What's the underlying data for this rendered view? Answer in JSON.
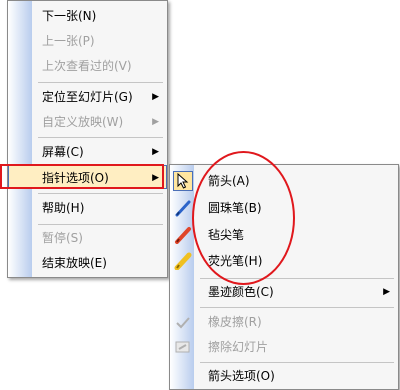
{
  "menu_main": {
    "items": [
      {
        "label": "下一张(N)",
        "disabled": false
      },
      {
        "label": "上一张(P)",
        "disabled": true
      },
      {
        "label": "上次查看过的(V)",
        "disabled": true
      },
      {
        "label": "定位至幻灯片(G)",
        "disabled": false,
        "submenu": true
      },
      {
        "label": "自定义放映(W)",
        "disabled": true,
        "submenu": true
      },
      {
        "label": "屏幕(C)",
        "disabled": false,
        "submenu": true
      },
      {
        "label": "指针选项(O)",
        "disabled": false,
        "submenu": true
      },
      {
        "label": "帮助(H)",
        "disabled": false
      },
      {
        "label": "暂停(S)",
        "disabled": true
      },
      {
        "label": "结束放映(E)",
        "disabled": false
      }
    ]
  },
  "menu_pointer": {
    "items": [
      {
        "label": "箭头(A)",
        "icon": "arrow-pointer-icon"
      },
      {
        "label": "圆珠笔(B)",
        "icon": "ballpoint-pen-icon"
      },
      {
        "label": "毡尖笔",
        "icon": "felt-tip-pen-icon"
      },
      {
        "label": "荧光笔(H)",
        "icon": "highlighter-icon"
      },
      {
        "label": "墨迹颜色(C)",
        "submenu": true
      },
      {
        "label": "橡皮擦(R)",
        "disabled": true,
        "icon": "eraser-icon"
      },
      {
        "label": "擦除幻灯片",
        "disabled": true,
        "icon": "erase-slide-icon"
      },
      {
        "label": "箭头选项(O)"
      }
    ]
  },
  "colors": {
    "annotation_red": "#e0181d",
    "highlight_bg": "#ffeec2",
    "highlight_border": "#4b6fb6"
  }
}
